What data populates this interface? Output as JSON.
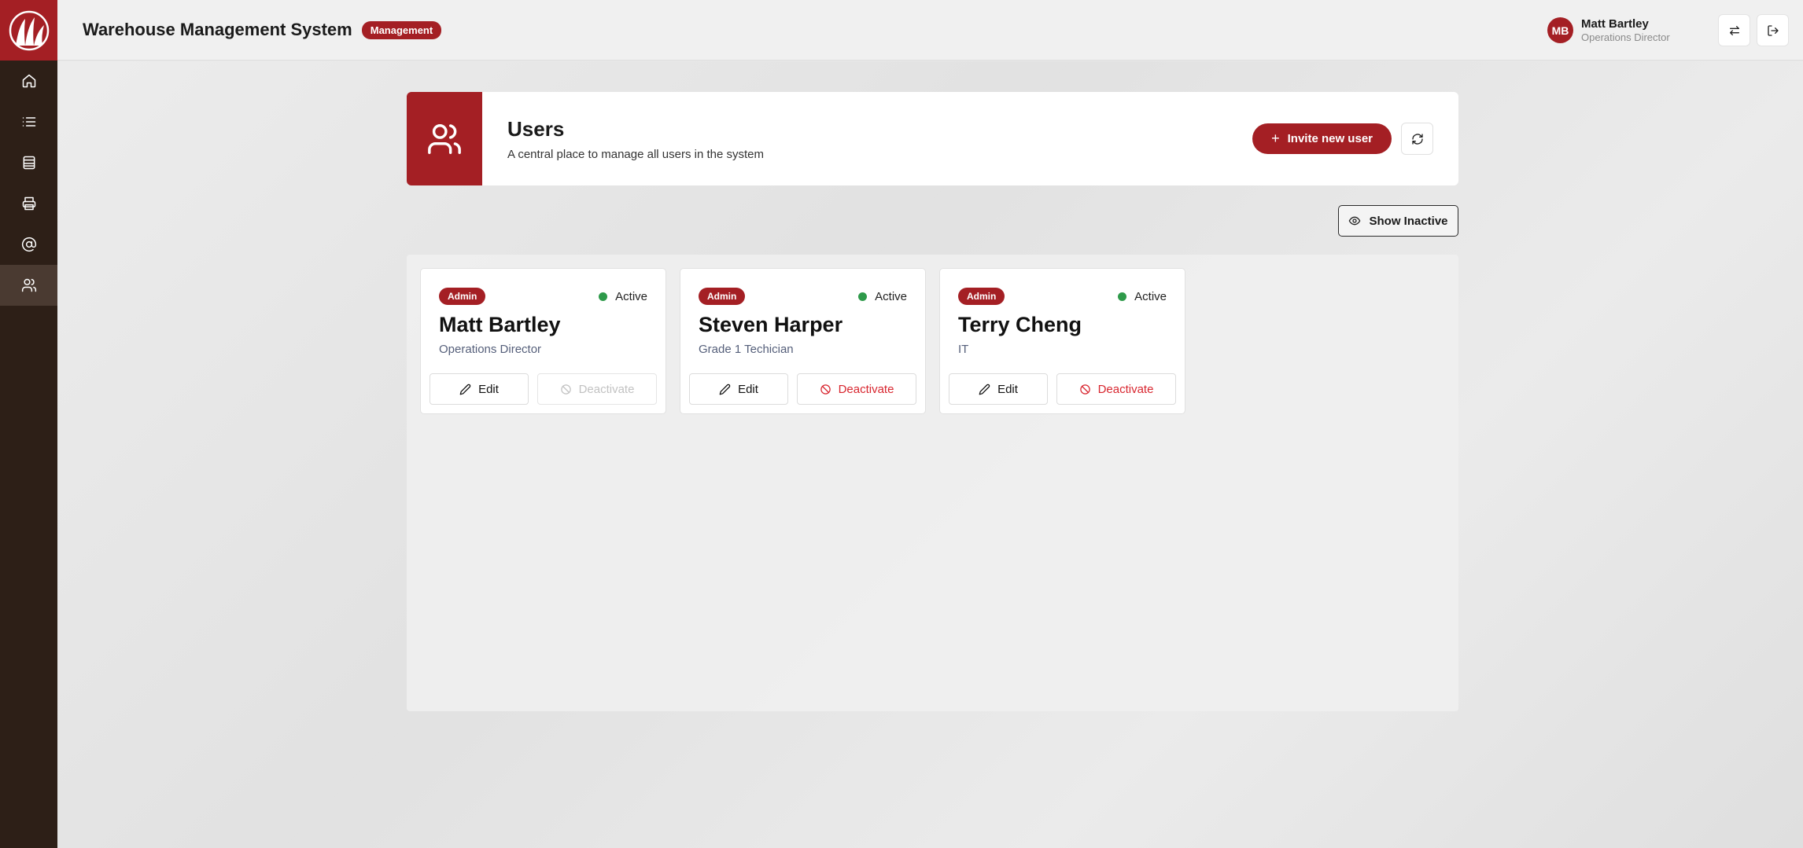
{
  "header": {
    "title": "Warehouse Management System",
    "badge": "Management",
    "user": {
      "initials": "MB",
      "name": "Matt Bartley",
      "role": "Operations Director"
    }
  },
  "sidebar": {
    "items": [
      {
        "icon": "home-icon"
      },
      {
        "icon": "list-icon"
      },
      {
        "icon": "inventory-icon"
      },
      {
        "icon": "printer-icon"
      },
      {
        "icon": "at-sign-icon"
      },
      {
        "icon": "users-icon",
        "active": true
      }
    ]
  },
  "page": {
    "title": "Users",
    "subtitle": "A central place to manage all users in the system",
    "invite_label": "Invite new user",
    "show_inactive_label": "Show Inactive"
  },
  "users": [
    {
      "role": "Admin",
      "status": "Active",
      "name": "Matt Bartley",
      "title": "Operations Director",
      "edit_label": "Edit",
      "deactivate_label": "Deactivate",
      "deactivate_disabled": true
    },
    {
      "role": "Admin",
      "status": "Active",
      "name": "Steven Harper",
      "title": "Grade 1 Techician",
      "edit_label": "Edit",
      "deactivate_label": "Deactivate",
      "deactivate_disabled": false
    },
    {
      "role": "Admin",
      "status": "Active",
      "name": "Terry Cheng",
      "title": "IT",
      "edit_label": "Edit",
      "deactivate_label": "Deactivate",
      "deactivate_disabled": false
    }
  ],
  "colors": {
    "brand": "#a41f24",
    "sidebar": "#2d1f17",
    "active_status": "#2e9a4a",
    "danger": "#d8262f"
  }
}
